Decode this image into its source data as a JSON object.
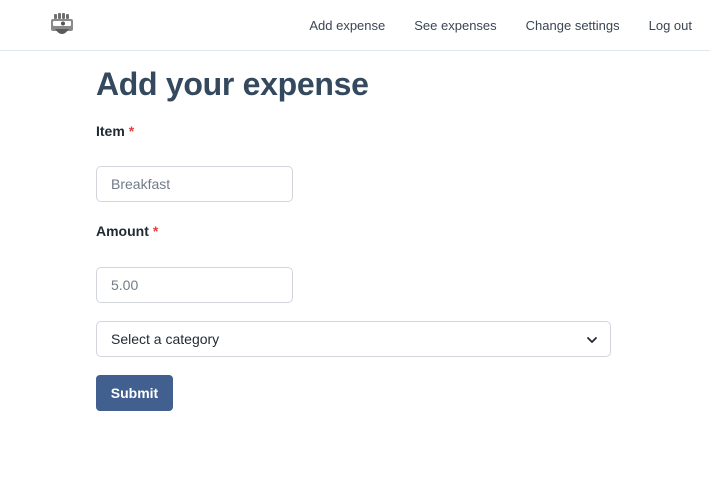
{
  "nav": {
    "logo_icon": "camera-mascot-logo-icon",
    "links": [
      "Add expense",
      "See expenses",
      "Change settings",
      "Log out"
    ]
  },
  "page": {
    "title": "Add your expense"
  },
  "form": {
    "item": {
      "label": "Item",
      "required_marker": "*",
      "placeholder": "Breakfast",
      "value": ""
    },
    "amount": {
      "label": "Amount",
      "required_marker": "*",
      "placeholder": "5.00",
      "value": ""
    },
    "category": {
      "selected": "Select a category",
      "icon": "chevron-down-icon"
    },
    "submit_label": "Submit"
  },
  "colors": {
    "primary_button": "#42608f",
    "title": "#34495e",
    "required": "#e53e3e",
    "border": "#d2d6dc"
  }
}
